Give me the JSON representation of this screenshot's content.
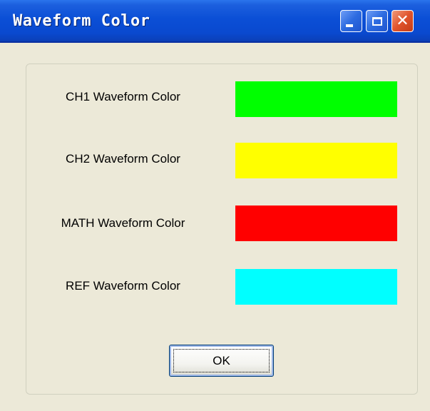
{
  "window": {
    "title": "Waveform Color"
  },
  "rows": [
    {
      "label": "CH1 Waveform Color",
      "color": "#00ff00"
    },
    {
      "label": "CH2 Waveform Color",
      "color": "#ffff00"
    },
    {
      "label": "MATH Waveform Color",
      "color": "#ff0000"
    },
    {
      "label": "REF Waveform Color",
      "color": "#00ffff"
    }
  ],
  "buttons": {
    "ok_label": "OK",
    "close_glyph": "✕"
  },
  "icons": {
    "minimize": "minimize-icon",
    "maximize": "maximize-icon",
    "close": "close-icon"
  }
}
